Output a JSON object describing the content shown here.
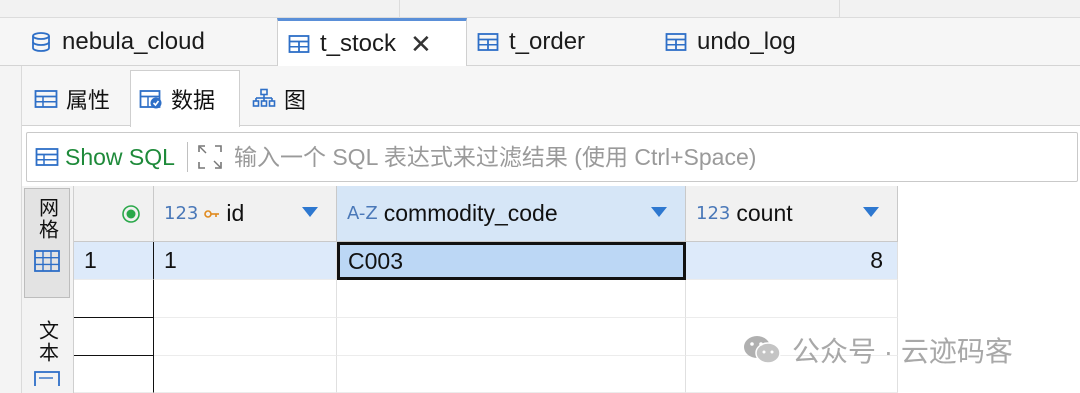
{
  "editor_tabs": [
    {
      "label": "nebula_cloud",
      "icon": "database-icon",
      "active": false
    },
    {
      "label": "t_stock",
      "icon": "table-icon",
      "active": true,
      "closable": true
    },
    {
      "label": "t_order",
      "icon": "table-icon",
      "active": false
    },
    {
      "label": "undo_log",
      "icon": "table-icon",
      "active": false
    }
  ],
  "sub_tabs": [
    {
      "label": "属性",
      "icon": "properties-icon"
    },
    {
      "label": "数据",
      "icon": "data-icon",
      "active": true
    },
    {
      "label": "图",
      "icon": "diagram-icon"
    }
  ],
  "filter": {
    "show_sql_label": "Show SQL",
    "placeholder": "输入一个 SQL 表达式来过滤结果 (使用 Ctrl+Space)"
  },
  "side_panel": {
    "grid_label": "网格",
    "text_label": "文本"
  },
  "table": {
    "columns": [
      {
        "type": "123",
        "name": "id",
        "key": true
      },
      {
        "type": "A-Z",
        "name": "commodity_code"
      },
      {
        "type": "123",
        "name": "count"
      }
    ],
    "rows": [
      {
        "num": "1",
        "id": "1",
        "commodity_code": "C003",
        "count": "8"
      }
    ]
  },
  "watermark": "公众号 · 云迹码客",
  "colors": {
    "accent": "#2e78d0",
    "show_sql": "#1e8a3a",
    "selected_row": "#ddeafa",
    "focused_cell": "#bcd7f5"
  }
}
